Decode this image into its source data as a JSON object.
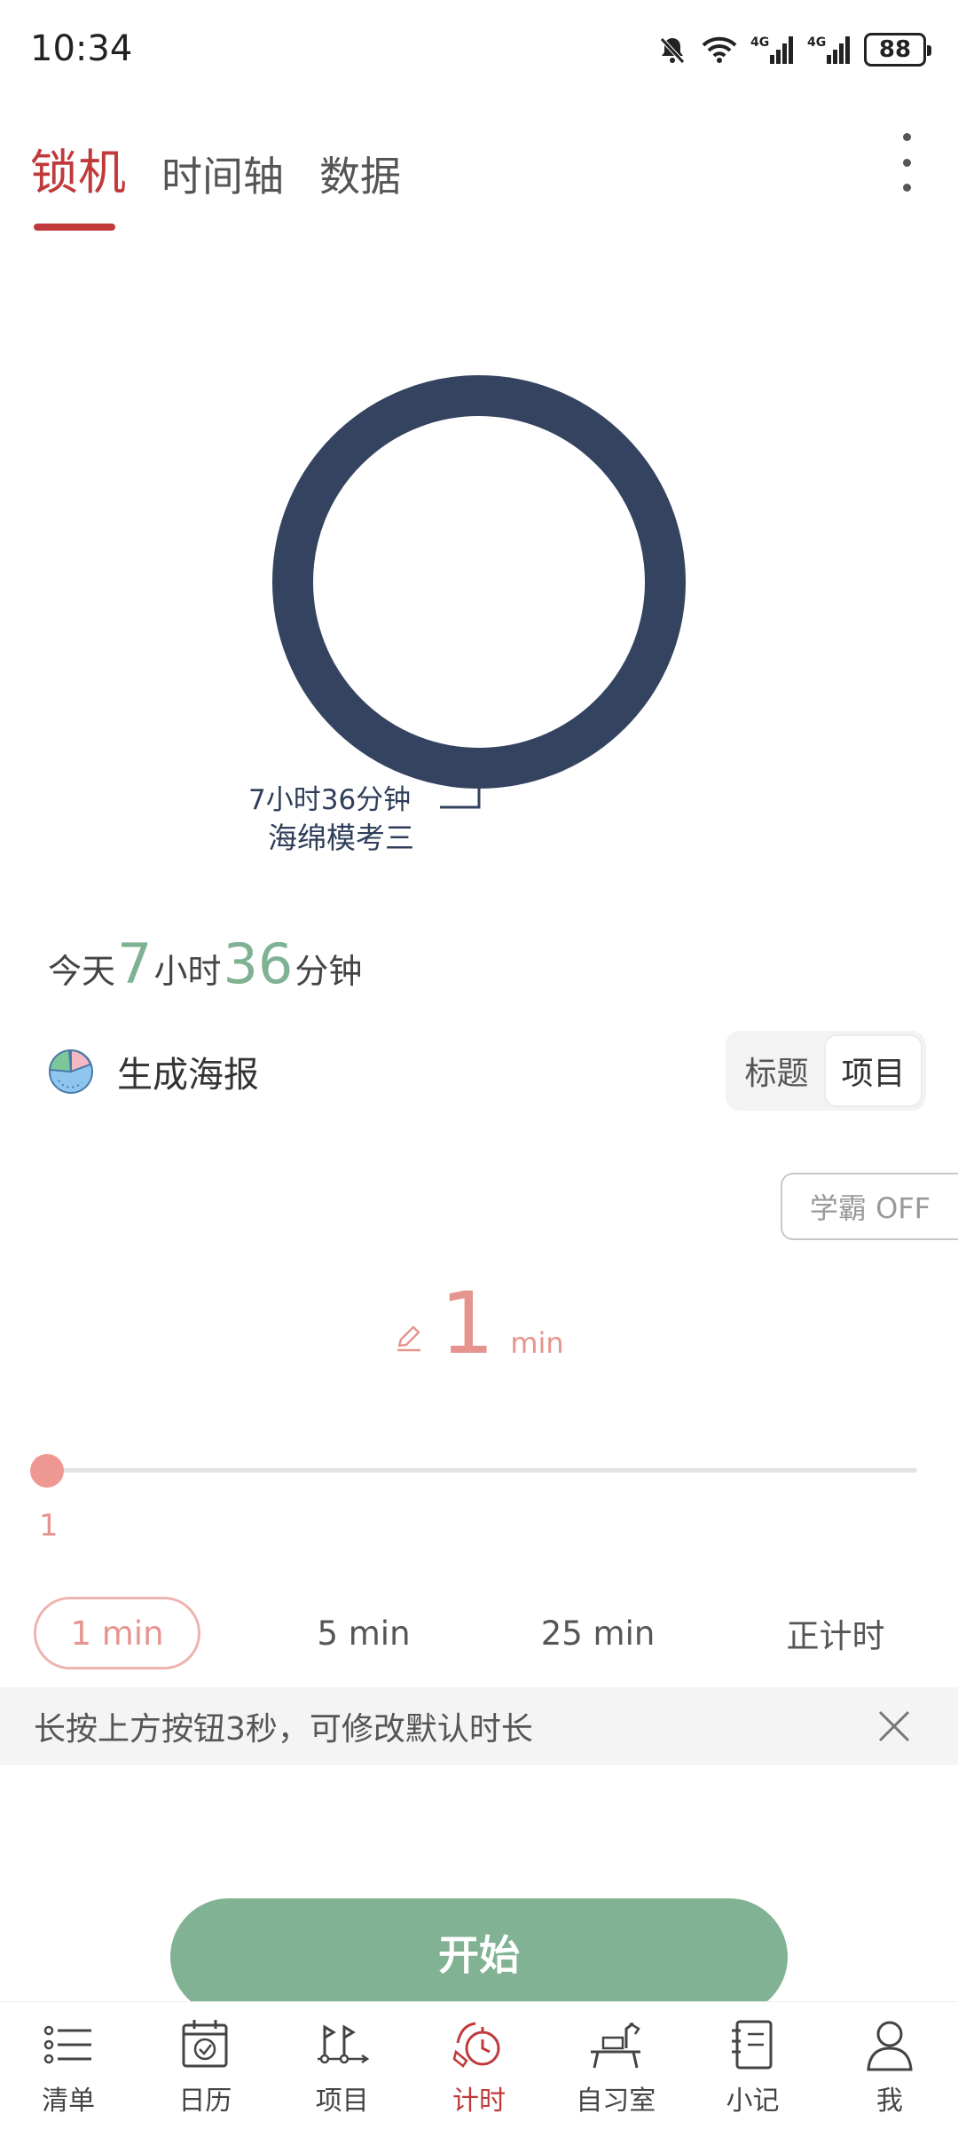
{
  "status_bar": {
    "time": "10:34",
    "battery": "88",
    "network_label": "4G"
  },
  "top_tabs": [
    {
      "label": "锁机",
      "active": true
    },
    {
      "label": "时间轴",
      "active": false
    },
    {
      "label": "数据",
      "active": false
    }
  ],
  "chart_data": {
    "type": "pie",
    "series": [
      {
        "name": "海绵模考三",
        "value_label": "7小时36分钟",
        "fraction": 1.0,
        "color": "#344460"
      }
    ]
  },
  "today": {
    "prefix": "今天",
    "hours": "7",
    "hours_unit": "小时",
    "minutes": "36",
    "minutes_unit": "分钟"
  },
  "poster": {
    "label": "生成海报",
    "icon": "pie-chart-icon"
  },
  "segment": [
    {
      "label": "标题",
      "active": false
    },
    {
      "label": "项目",
      "active": true
    }
  ],
  "xueba_toggle": {
    "label": "学霸 OFF"
  },
  "duration": {
    "value": "1",
    "unit": "min",
    "icon": "edit-pencil-icon"
  },
  "slider": {
    "value": "1",
    "fraction": 0.0
  },
  "presets": [
    {
      "label": "1 min",
      "active": true
    },
    {
      "label": "5 min",
      "active": false
    },
    {
      "label": "25 min",
      "active": false
    },
    {
      "label": "正计时",
      "active": false
    }
  ],
  "tip": {
    "text": "长按上方按钮3秒，可修改默认时长"
  },
  "start_button": {
    "label": "开始"
  },
  "colors": {
    "accent_red": "#c0393b",
    "green": "#80b293",
    "salmon": "#e6948f",
    "donut_navy": "#344460"
  },
  "bottom_nav": [
    {
      "label": "清单",
      "icon": "list-icon",
      "active": false
    },
    {
      "label": "日历",
      "icon": "calendar-icon",
      "active": false
    },
    {
      "label": "项目",
      "icon": "project-icon",
      "active": false
    },
    {
      "label": "计时",
      "icon": "timer-icon",
      "active": true
    },
    {
      "label": "自习室",
      "icon": "study-room-icon",
      "active": false
    },
    {
      "label": "小记",
      "icon": "notebook-icon",
      "active": false
    },
    {
      "label": "我",
      "icon": "user-icon",
      "active": false
    }
  ]
}
